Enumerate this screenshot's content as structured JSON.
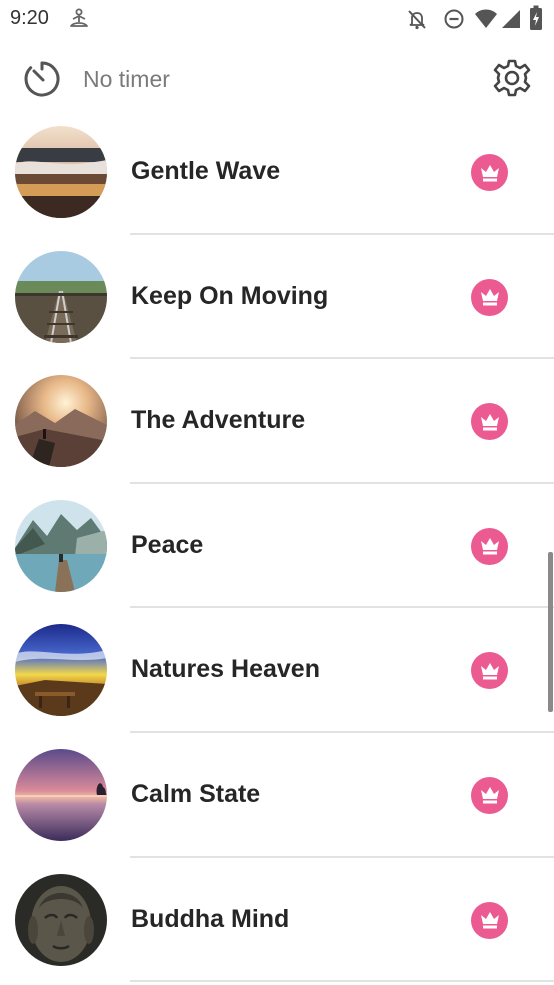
{
  "status_bar": {
    "time": "9:20",
    "icons": [
      "person-meditating-icon",
      "notifications-off-icon",
      "do-not-disturb-icon",
      "wifi-icon",
      "cellular-icon",
      "battery-charging-icon"
    ]
  },
  "header": {
    "timer_label": "No timer",
    "timer_icon": "timer-icon",
    "settings_icon": "gear-icon"
  },
  "sounds": [
    {
      "title": "Gentle Wave",
      "image": "beach-wave-sunset",
      "premium": true
    },
    {
      "title": "Keep On Moving",
      "image": "railway-tracks",
      "premium": true
    },
    {
      "title": "The Adventure",
      "image": "mountain-sunrise-hiker",
      "premium": true
    },
    {
      "title": "Peace",
      "image": "fjord-pier",
      "premium": true
    },
    {
      "title": "Natures Heaven",
      "image": "sunset-valley-clouds",
      "premium": true
    },
    {
      "title": "Calm State",
      "image": "purple-sea-dusk",
      "premium": true
    },
    {
      "title": "Buddha Mind",
      "image": "buddha-statue-face",
      "premium": true
    }
  ],
  "colors": {
    "premium_badge": "#ec5a92",
    "divider": "#e2e2e2",
    "title_text": "#262626",
    "timer_text": "#7a7a7a"
  }
}
